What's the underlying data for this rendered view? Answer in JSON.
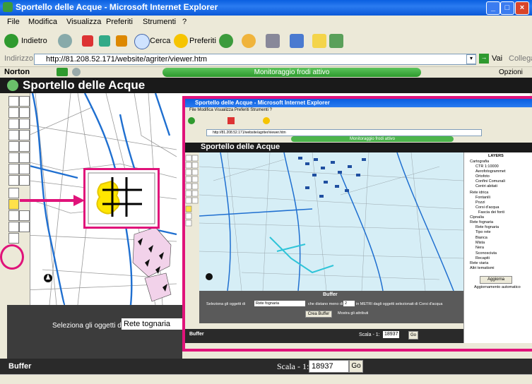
{
  "window": {
    "title": "Sportello delle Acque - Microsoft Internet Explorer",
    "controls": [
      "_",
      "□",
      "×"
    ]
  },
  "menu": [
    "File",
    "Modifica",
    "Visualizza",
    "Preferiti",
    "Strumenti",
    "?"
  ],
  "toolbar": {
    "back": "Indietro",
    "search": "Cerca",
    "favorites": "Preferiti"
  },
  "address": {
    "label": "Indirizzo",
    "url": "http://81.208.52.171/website/agriter/viewer.htm",
    "go": "Vai",
    "links": "Collegamenti"
  },
  "norton": {
    "brand": "Norton",
    "status": "Monitoraggio frodi attivo",
    "options": "Opzioni"
  },
  "app": {
    "title": "Sportello delle Acque",
    "selection_label": "Seleziona gli oggetti di",
    "selection_value": "Rete tognaria",
    "footer_label": "Buffer",
    "scale_label": "Scala - 1:",
    "scale_value": "18937",
    "go": "Go"
  },
  "inset": {
    "window_title": "Sportello delle Acque - Microsoft Internet Explorer",
    "menu": "File  Modifica  Visualizza  Preferiti  Strumenti  ?",
    "address": "http://81.208.52.171/website/agriter/viewer.htm",
    "norton_status": "Monitoraggio frodi attivo",
    "app_title": "Sportello delle Acque",
    "layers_title": "LAYERS",
    "layers": [
      "Cartografia",
      "CTR 1:10000",
      "Aerofotogrammet",
      "Ortofoto",
      "Confini Comunali",
      "Centri abitati",
      "Rete idrica",
      "Fontanili",
      "Pozzi",
      "Corsi d'acqua",
      "Fascia dei fonti",
      "Cipnalia",
      "Rete fognaria",
      "Rete fognaria",
      "Tipo rete",
      "Bianca",
      "Mista",
      "Nera",
      "Sconosciuta",
      "Recapiti",
      "Rete viaria",
      "Altri tematismi"
    ],
    "refresh_button": "Aggiorna",
    "auto_update": "Aggiornamento automatico",
    "buffer_title": "Buffer",
    "buffer_row1_a": "Seleziona gli oggetti di",
    "buffer_row1_select": "Rete fognaria",
    "buffer_row1_b": "che distano meno di",
    "buffer_row1_value": "2",
    "buffer_row1_c": "in METRI dagli oggetti selezionati di Corsi d'acqua",
    "buffer_button": "Crea Buffer",
    "buffer_checkbox": "Mostra gli attributi",
    "footer_label": "Buffer",
    "scale_label": "Scala - 1:",
    "scale_value": "18937",
    "go": "Go"
  },
  "colors": {
    "highlight": "#e0137a",
    "title_blue": "#0a5fe0",
    "norton_green": "#3aa83a",
    "map_river": "#1f6fd0",
    "inset_water": "#2ec4d8"
  },
  "icons": {
    "buffer_tool": "grid-hash-icon",
    "north_arrow": "north-arrow-icon"
  }
}
